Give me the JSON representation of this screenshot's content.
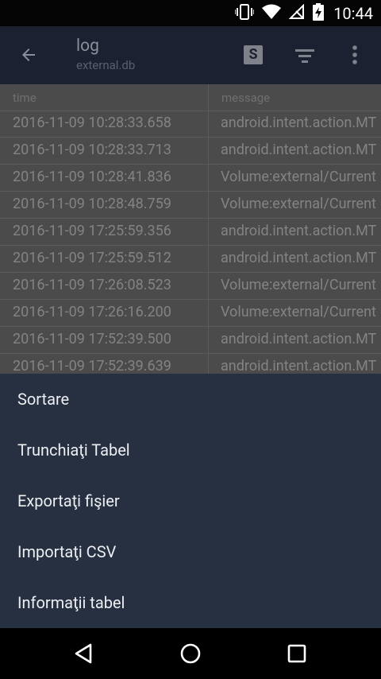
{
  "status_bar": {
    "time": "10:44",
    "icons": [
      "vibrate-icon",
      "wifi-icon",
      "no-signal-icon",
      "battery-charging-icon"
    ]
  },
  "app_bar": {
    "title": "log",
    "subtitle": "external.db",
    "actions": [
      "sql-icon",
      "filter-icon",
      "more-vert-icon"
    ]
  },
  "table": {
    "columns": [
      "time",
      "message"
    ],
    "rows": [
      {
        "time": "2016-11-09 10:28:33.658",
        "message": "android.intent.action.MT"
      },
      {
        "time": "2016-11-09 10:28:33.713",
        "message": "android.intent.action.MT"
      },
      {
        "time": "2016-11-09 10:28:41.836",
        "message": "Volume:external/Current"
      },
      {
        "time": "2016-11-09 10:28:48.759",
        "message": "Volume:external/Current"
      },
      {
        "time": "2016-11-09 17:25:59.356",
        "message": "android.intent.action.MT"
      },
      {
        "time": "2016-11-09 17:25:59.512",
        "message": "android.intent.action.MT"
      },
      {
        "time": "2016-11-09 17:26:08.523",
        "message": "Volume:external/Current"
      },
      {
        "time": "2016-11-09 17:26:16.200",
        "message": "Volume:external/Current"
      },
      {
        "time": "2016-11-09 17:52:39.500",
        "message": "android.intent.action.MT"
      },
      {
        "time": "2016-11-09 17:52:39.639",
        "message": "android.intent.action.MT"
      }
    ]
  },
  "menu": {
    "items": [
      {
        "label": "Sortare"
      },
      {
        "label": "Trunchiaţi Tabel"
      },
      {
        "label": "Exportaţi fişier"
      },
      {
        "label": "Importaţi CSV"
      },
      {
        "label": "Informaţii tabel"
      }
    ]
  },
  "nav_bar": {
    "buttons": [
      "back-triangle-icon",
      "home-circle-icon",
      "recents-square-icon"
    ]
  }
}
